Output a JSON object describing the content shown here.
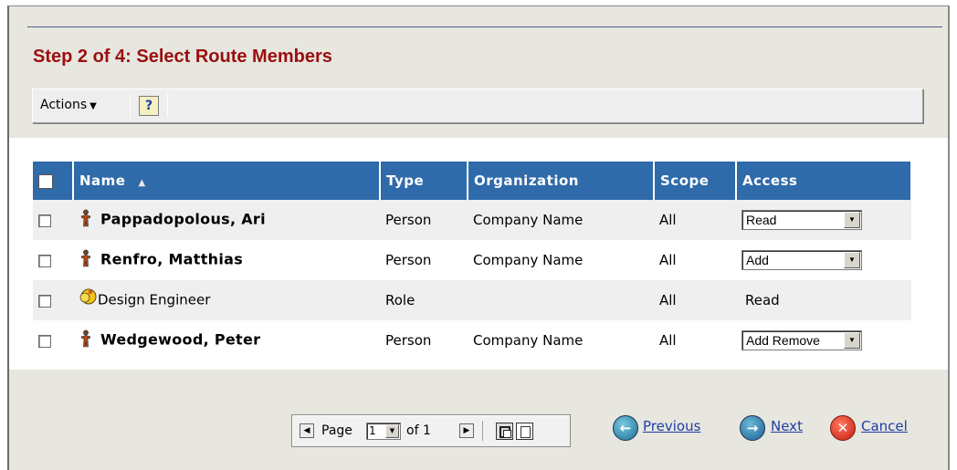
{
  "title": "Step 2 of 4: Select Route Members",
  "toolbar": {
    "actions_label": "Actions",
    "actions_caret": "▼",
    "help_icon": "help-icon",
    "help_glyph": "?"
  },
  "table": {
    "headers": {
      "name": "Name",
      "sort_indicator": "▲",
      "type": "Type",
      "organization": "Organization",
      "scope": "Scope",
      "access": "Access"
    },
    "rows": [
      {
        "name": "Pappadopolous, Ari",
        "kind": "person",
        "type": "Person",
        "organization": "Company Name",
        "scope": "All",
        "access": "Read",
        "access_editable": true
      },
      {
        "name": "Renfro, Matthias",
        "kind": "person",
        "type": "Person",
        "organization": "Company Name",
        "scope": "All",
        "access": "Add",
        "access_editable": true
      },
      {
        "name": "Design Engineer",
        "kind": "role",
        "type": "Role",
        "organization": "",
        "scope": "All",
        "access": "Read",
        "access_editable": false
      },
      {
        "name": "Wedgewood, Peter",
        "kind": "person",
        "type": "Person",
        "organization": "Company Name",
        "scope": "All",
        "access": "Add Remove",
        "access_editable": true
      }
    ]
  },
  "pager": {
    "page_label": "Page",
    "page_value": "1",
    "of_label": "of 1"
  },
  "nav": {
    "previous": "Previous",
    "next": "Next",
    "cancel": "Cancel"
  },
  "colors": {
    "title": "#9a0f0f",
    "header_bg": "#2f6aaa",
    "band_bg": "#e7e6df",
    "link": "#1f3fa8"
  }
}
